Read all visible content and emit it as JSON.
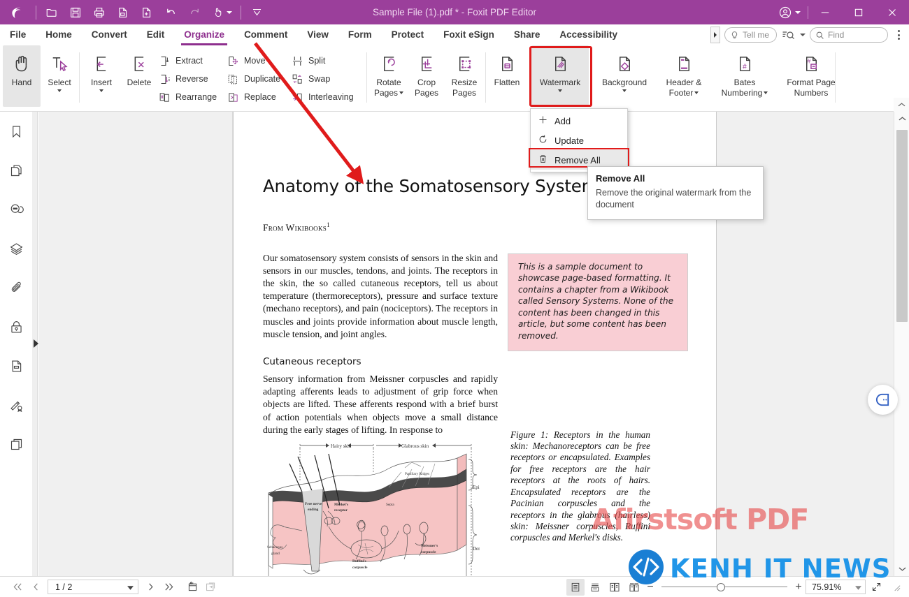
{
  "titlebar": {
    "title": "Sample File (1).pdf * - Foxit PDF Editor",
    "quick_access": [
      "open-icon",
      "save-icon",
      "print-icon",
      "export-icon",
      "create-pdf-icon",
      "undo-icon",
      "redo-icon",
      "touch-mode-icon",
      "customize-icon"
    ],
    "window_controls": [
      "account-icon",
      "minimize-icon",
      "maximize-icon",
      "close-icon"
    ]
  },
  "menubar": {
    "tabs": [
      {
        "label": "File",
        "active": false
      },
      {
        "label": "Home",
        "active": false
      },
      {
        "label": "Convert",
        "active": false
      },
      {
        "label": "Edit",
        "active": false
      },
      {
        "label": "Organize",
        "active": true
      },
      {
        "label": "Comment",
        "active": false
      },
      {
        "label": "View",
        "active": false
      },
      {
        "label": "Form",
        "active": false
      },
      {
        "label": "Protect",
        "active": false
      },
      {
        "label": "Foxit eSign",
        "active": false
      },
      {
        "label": "Share",
        "active": false
      },
      {
        "label": "Accessibility",
        "active": false
      }
    ],
    "tell_me_placeholder": "Tell me",
    "find_placeholder": "Find"
  },
  "ribbon": {
    "tools": [
      {
        "label": "Hand",
        "icon": "hand-icon",
        "selected": true,
        "dropdown": false
      },
      {
        "label": "Select",
        "icon": "select-icon",
        "selected": false,
        "dropdown": true
      }
    ],
    "page_tools": [
      {
        "label": "Insert",
        "icon": "insert-page-icon",
        "dropdown": true
      },
      {
        "label": "Delete",
        "icon": "delete-page-icon",
        "dropdown": false
      }
    ],
    "small_col1": [
      {
        "label": "Extract",
        "icon": "extract-icon"
      },
      {
        "label": "Reverse",
        "icon": "reverse-icon"
      },
      {
        "label": "Rearrange",
        "icon": "rearrange-icon"
      }
    ],
    "small_col2": [
      {
        "label": "Move",
        "icon": "move-icon"
      },
      {
        "label": "Duplicate",
        "icon": "duplicate-icon"
      },
      {
        "label": "Replace",
        "icon": "replace-icon"
      }
    ],
    "small_col3": [
      {
        "label": "Split",
        "icon": "split-icon"
      },
      {
        "label": "Swap",
        "icon": "swap-icon"
      },
      {
        "label": "Interleaving",
        "icon": "interleaving-icon"
      }
    ],
    "big_buttons": [
      {
        "label": "Rotate\nPages",
        "line1": "Rotate",
        "line2": "Pages",
        "icon": "rotate-pages-icon",
        "dropdown": true,
        "highlighted": false
      },
      {
        "label": "Crop Pages",
        "line1": "Crop",
        "line2": "Pages",
        "icon": "crop-pages-icon",
        "dropdown": false,
        "highlighted": false
      },
      {
        "label": "Resize Pages",
        "line1": "Resize",
        "line2": "Pages",
        "icon": "resize-pages-icon",
        "dropdown": false,
        "highlighted": false
      },
      {
        "label": "Flatten",
        "line1": "Flatten",
        "line2": "",
        "icon": "flatten-icon",
        "dropdown": false,
        "highlighted": false
      },
      {
        "label": "Watermark",
        "line1": "Watermark",
        "line2": "",
        "icon": "watermark-icon",
        "dropdown": true,
        "highlighted": true
      },
      {
        "label": "Background",
        "line1": "Background",
        "line2": "",
        "icon": "background-icon",
        "dropdown": true,
        "highlighted": false
      },
      {
        "label": "Header & Footer",
        "line1": "Header &",
        "line2": "Footer",
        "icon": "header-footer-icon",
        "dropdown": true,
        "highlighted": false
      },
      {
        "label": "Bates Numbering",
        "line1": "Bates",
        "line2": "Numbering",
        "icon": "bates-numbering-icon",
        "dropdown": true,
        "highlighted": false
      },
      {
        "label": "Format Page Numbers",
        "line1": "Format Page",
        "line2": "Numbers",
        "icon": "format-page-numbers-icon",
        "dropdown": false,
        "highlighted": false
      }
    ]
  },
  "watermark_menu": {
    "items": [
      {
        "label": "Add",
        "icon": "plus-icon",
        "highlighted": false
      },
      {
        "label": "Update",
        "icon": "refresh-icon",
        "highlighted": false
      },
      {
        "label": "Remove All",
        "icon": "trash-icon",
        "highlighted": true
      }
    ]
  },
  "tooltip": {
    "title": "Remove All",
    "body": "Remove the original watermark from the document"
  },
  "left_rail": {
    "items": [
      {
        "name": "bookmarks-icon"
      },
      {
        "name": "page-thumbnails-icon"
      },
      {
        "name": "comments-icon"
      },
      {
        "name": "layers-icon"
      },
      {
        "name": "attachments-icon"
      },
      {
        "name": "security-icon"
      },
      {
        "name": "fields-icon"
      },
      {
        "name": "signatures-icon"
      },
      {
        "name": "stamps-icon"
      }
    ]
  },
  "document": {
    "heading": "Anatomy of the Somatosensory System",
    "from_line": "From Wikibooks",
    "from_sup": "1",
    "paragraph1": "Our somatosensory system consists of sensors in the skin and sensors in our muscles, tendons, and joints. The receptors in the skin, the so called cutaneous receptors, tell us about temperature (thermoreceptors), pressure and surface texture (mechano receptors), and pain (nociceptors). The receptors in muscles and joints provide information about muscle length, muscle tension, and joint angles.",
    "section_heading": "Cutaneous receptors",
    "paragraph2": "Sensory information from Meissner corpuscles and rapidly adapting afferents leads to adjustment of grip force when objects are lifted. These afferents respond with a brief burst of action potentials when objects move a small distance during the early stages of lifting. In response to",
    "callout": "This is a sample document to showcase page-based formatting. It contains a chapter from a Wikibook called Sensory Systems. None of the content has been changed in this article, but some content has been removed.",
    "figure_caption": "Figure 1:  Receptors in the human skin: Mechanoreceptors can be free receptors or encapsulated. Examples for free receptors are the hair receptors at the roots of hairs. Encapsulated receptors are the Pacinian corpuscles and the receptors in the glabrous (hairless) skin: Meissner corpuscles, Ruffini corpuscles and Merkel's disks.",
    "page_watermark": "Afirstsoft PDF",
    "figure_labels": {
      "hairy_skin": "Hairy skin",
      "glabrous_skin": "Glabrous skin",
      "papillary_ridges": "Papillary Ridges",
      "epidermis": "Epidermis",
      "dermis": "Dermis",
      "septa": "Septa",
      "free_nerve_ending": "Free nerve ending",
      "merkel": "Merkel's receptor",
      "sebaceous": "Sebaceous gland",
      "ruffini": "Ruffini's corpuscle",
      "meissner": "Meissner's corpuscle"
    }
  },
  "statusbar": {
    "first_page_icon": "first-page-icon",
    "prev_page_icon": "prev-page-icon",
    "page_value": "1 / 2",
    "next_page_icon": "next-page-icon",
    "last_page_icon": "last-page-icon",
    "rotate_view_icon": "rotate-view-icon",
    "fit_window_icon": "fit-window-icon",
    "view_modes": [
      {
        "name": "single-page-view",
        "selected": true
      },
      {
        "name": "continuous-view",
        "selected": false
      },
      {
        "name": "facing-view",
        "selected": false
      },
      {
        "name": "facing-continuous-view",
        "selected": false
      }
    ],
    "zoom_out": "−",
    "zoom_in": "+",
    "zoom_value": "75.91%",
    "fullscreen_icon": "fullscreen-icon"
  },
  "overlay_watermark": {
    "text": "KENH IT NEWS",
    "logo": "code-brackets-logo",
    "color": "#2196e8"
  },
  "colors": {
    "brand_purple": "#9b3f9b",
    "accent_purple": "#8e2f8e",
    "highlight_red": "#e01b1b",
    "callout_pink": "#f9ced4",
    "watermark_red": "#e74c4c"
  }
}
